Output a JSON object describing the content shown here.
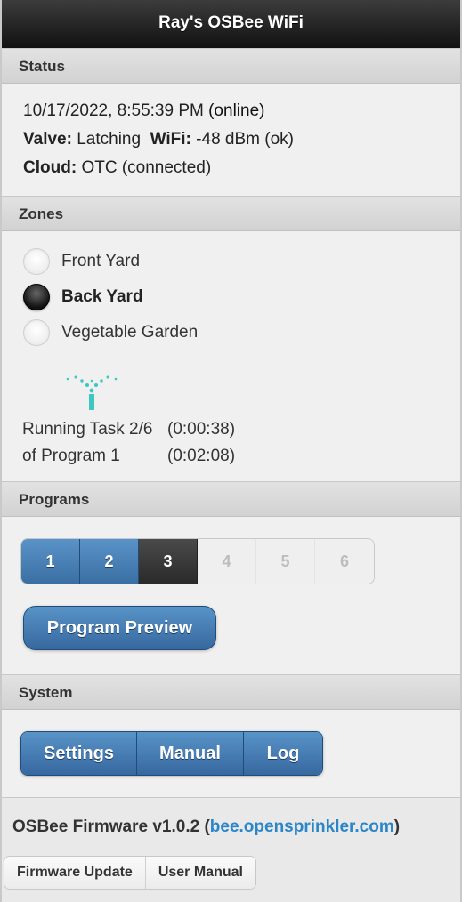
{
  "header": {
    "title": "Ray's OSBee WiFi"
  },
  "status": {
    "heading": "Status",
    "datetime": "10/17/2022, 8:55:39 PM",
    "online": "(online)",
    "valve_label": "Valve:",
    "valve_value": "Latching",
    "wifi_label": "WiFi:",
    "wifi_value": "-48 dBm (ok)",
    "cloud_label": "Cloud:",
    "cloud_value": "OTC (connected)"
  },
  "zones": {
    "heading": "Zones",
    "items": [
      {
        "label": "Front Yard",
        "selected": false
      },
      {
        "label": "Back Yard",
        "selected": true
      },
      {
        "label": "Vegetable Garden",
        "selected": false
      }
    ],
    "sprinkler_icon": "sprinkler-icon",
    "sprinkler_color": "#3cc8c0",
    "running_line1": "Running Task 2/6",
    "running_time1": "(0:00:38)",
    "running_line2": "of Program 1",
    "running_time2": "(0:02:08)"
  },
  "programs": {
    "heading": "Programs",
    "buttons": [
      {
        "label": "1",
        "state": "active"
      },
      {
        "label": "2",
        "state": "active"
      },
      {
        "label": "3",
        "state": "selected"
      },
      {
        "label": "4",
        "state": "disabled"
      },
      {
        "label": "5",
        "state": "disabled"
      },
      {
        "label": "6",
        "state": "disabled"
      }
    ],
    "preview_label": "Program Preview"
  },
  "system": {
    "heading": "System",
    "settings_label": "Settings",
    "manual_label": "Manual",
    "log_label": "Log"
  },
  "footer": {
    "firmware_text": "OSBee Firmware v1.0.2 (",
    "firmware_link": "bee.opensprinkler.com",
    "firmware_close": ")",
    "firmware_update_label": "Firmware Update",
    "user_manual_label": "User Manual"
  },
  "colors": {
    "accent_blue": "#3a6fa3",
    "link_blue": "#2a86c8",
    "header_black": "#111111"
  }
}
